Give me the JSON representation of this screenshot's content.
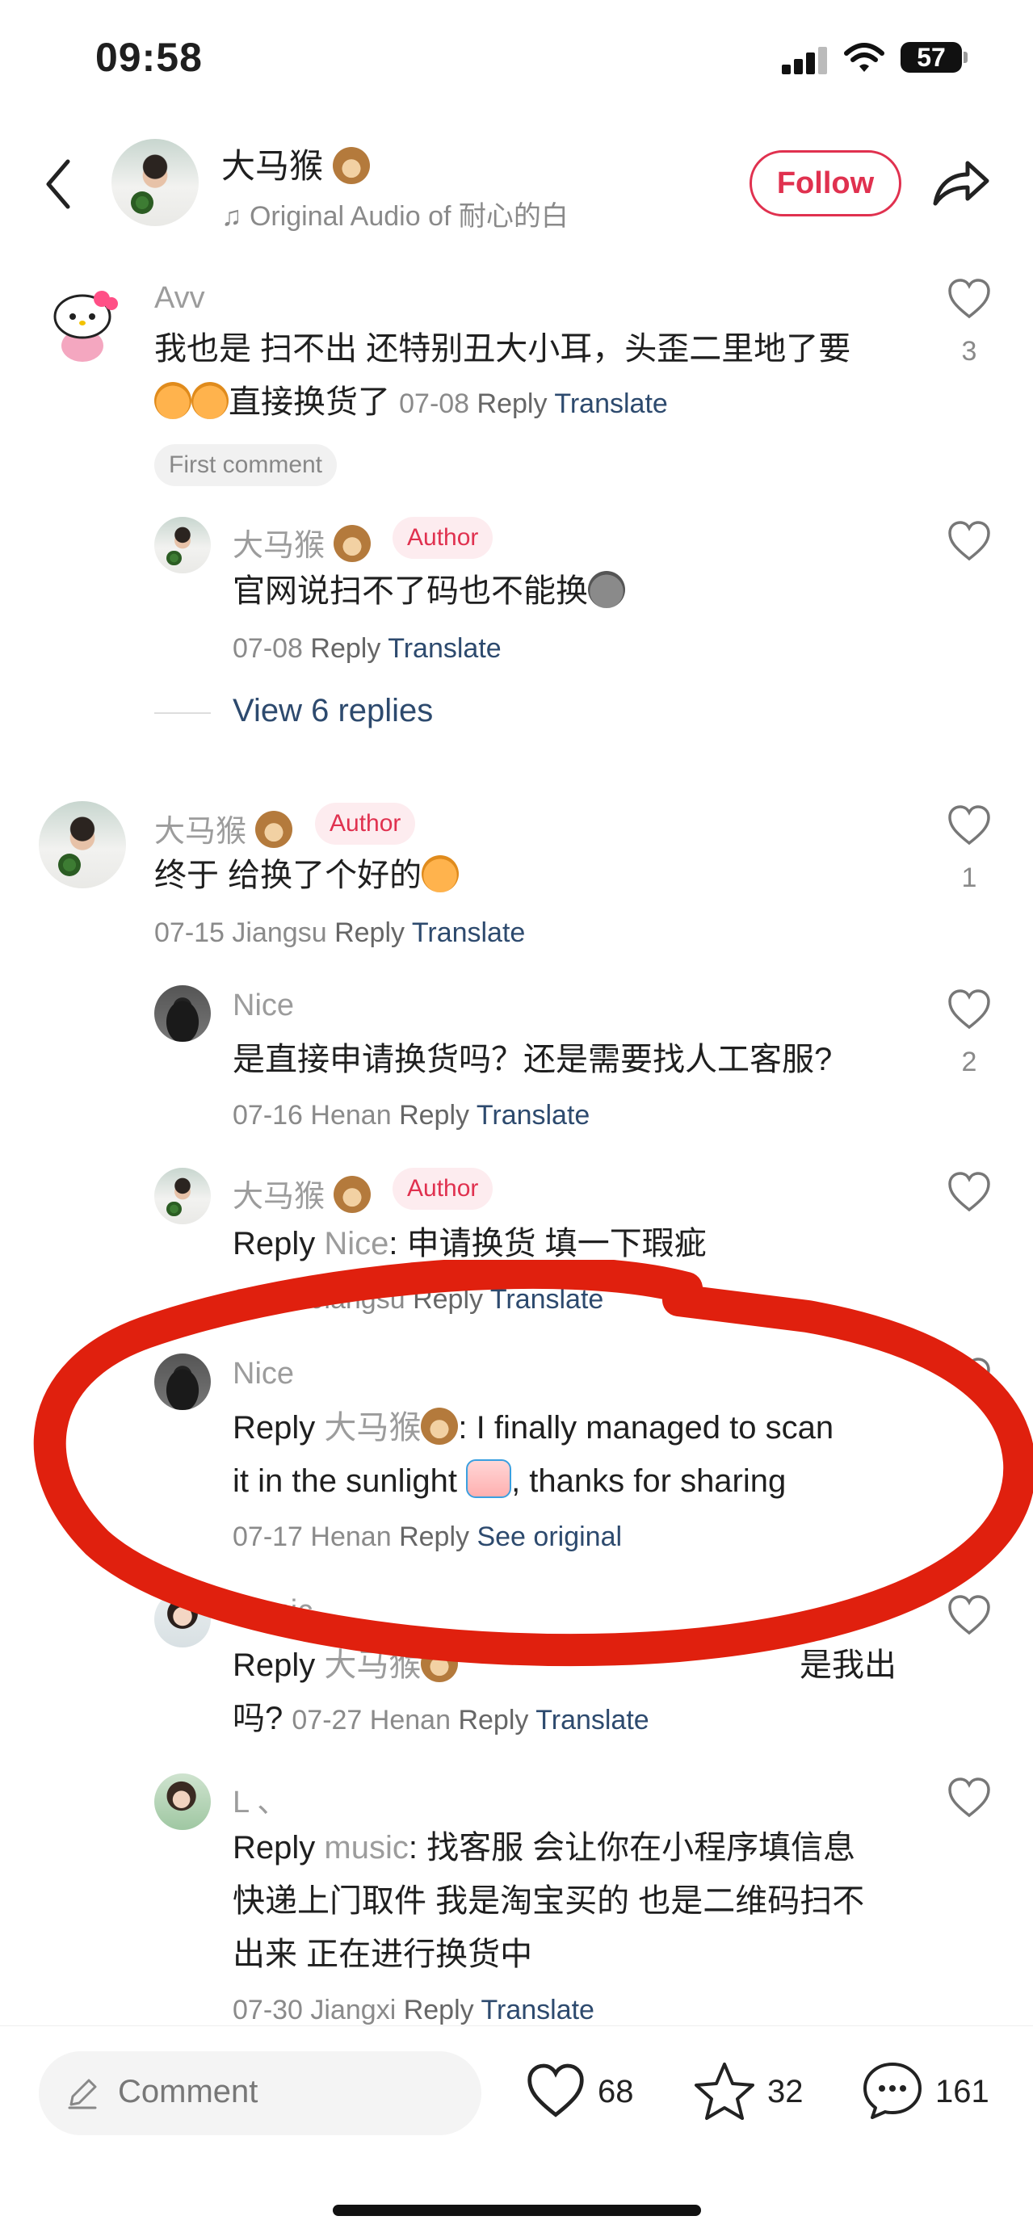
{
  "status": {
    "time": "09:58",
    "battery": "57"
  },
  "header": {
    "username": "大马猴",
    "audio_label": "Original Audio of 耐心的白",
    "follow_label": "Follow"
  },
  "comments": {
    "c1": {
      "user": "Avv",
      "text_line1": "我也是 扫不出 还特别丑大小耳，头歪二里地了要",
      "text_line2": "直接换货了",
      "date": "07-08",
      "reply": "Reply",
      "translate": "Translate",
      "likes": "3",
      "first_badge": "First comment"
    },
    "c1r1": {
      "user": "大马猴",
      "author_badge": "Author",
      "text": "官网说扫不了码也不能换",
      "date": "07-08",
      "reply": "Reply",
      "translate": "Translate"
    },
    "view_replies": "View 6 replies",
    "c2": {
      "user": "大马猴",
      "author_badge": "Author",
      "text": "终于  给换了个好的",
      "date": "07-15",
      "location": "Jiangsu",
      "reply": "Reply",
      "translate": "Translate",
      "likes": "1"
    },
    "c2r1": {
      "user": "Nice",
      "text": "是直接申请换货吗？还是需要找人工客服?",
      "date": "07-16",
      "location": "Henan",
      "reply": "Reply",
      "translate": "Translate",
      "likes": "2"
    },
    "c2r2": {
      "user": "大马猴",
      "author_badge": "Author",
      "reply_prefix": "Reply",
      "reply_to": "Nice",
      "text": ": 申请换货 填一下瑕疵",
      "date": "07-16",
      "location": "Jiangsu",
      "reply": "Reply",
      "translate": "Translate"
    },
    "c2r3": {
      "user": "Nice",
      "reply_prefix": "Reply",
      "reply_to": "大马猴",
      "text_line1": ": I finally managed to scan",
      "text_line2a": "it in the sunlight",
      "text_line2b": ", thanks for sharing",
      "date": "07-17",
      "location": "Henan",
      "reply": "Reply",
      "see_original": "See original"
    },
    "c2r4": {
      "user": "music",
      "reply_prefix": "Reply",
      "reply_to": "大马猴",
      "text_line1_end": "是我出",
      "text_line2": "吗?",
      "date": "07-27",
      "location": "Henan",
      "reply": "Reply",
      "translate": "Translate"
    },
    "c2r5": {
      "user": "L 、",
      "reply_prefix": "Reply",
      "reply_to": "music",
      "text_line1": ": 找客服 会让你在小程序填信息",
      "text_line2": "快递上门取件 我是淘宝买的 也是二维码扫不",
      "text_line3": "出来 正在进行换货中",
      "date": "07-30",
      "location": "Jiangxi",
      "reply": "Reply",
      "translate": "Translate"
    }
  },
  "bottom": {
    "comment_placeholder": "Comment",
    "likes": "68",
    "favorites": "32",
    "comments": "161"
  },
  "colors": {
    "accent": "#e0314f",
    "annotation": "#e0200e",
    "link": "#2d4a6e"
  }
}
